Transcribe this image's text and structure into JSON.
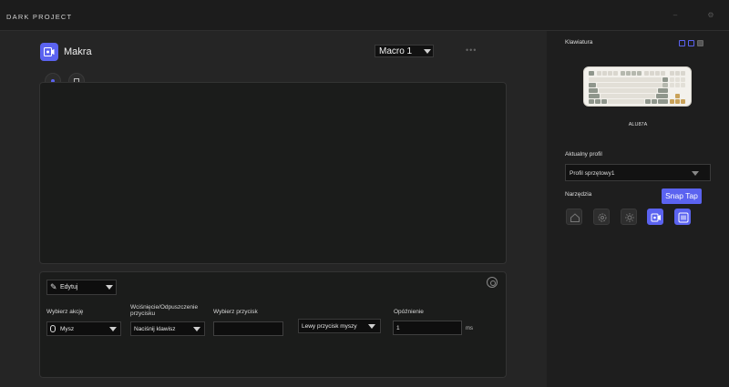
{
  "titlebar": {
    "brand": "DARK PROJECT"
  },
  "header": {
    "title": "Makra",
    "macro_selected": "Macro 1"
  },
  "action_panel": {
    "mode": "Edytuj",
    "fields": {
      "action": {
        "label": "Wybierz akcję",
        "value": "Mysz"
      },
      "press_release": {
        "label": "Wciśnięcie/Odpuszczenie przycisku",
        "value": "Naciśnij klawisz"
      },
      "button": {
        "label": "Wybierz przycisk",
        "value": ""
      },
      "mouse_button": {
        "value": "Lewy przycisk myszy"
      },
      "delay": {
        "label": "Opóźnienie",
        "value": "1",
        "unit": "ms"
      }
    }
  },
  "sidebar": {
    "keyboard_label": "Klawiatura",
    "keyboard_model": "ALU87A",
    "profile_label": "Aktualny profil",
    "profile_value": "Profil sprzętowy1",
    "tools_label": "Narzędzia",
    "tooltip": "Snap Tap",
    "tools": [
      "home-icon",
      "settings-icon",
      "lighting-icon",
      "macro-icon",
      "snap-tap-icon"
    ]
  },
  "colors": {
    "accent": "#5b63f0",
    "background": "#262626",
    "sidebar": "#1e1e1e",
    "panel": "#1b1c1b"
  }
}
